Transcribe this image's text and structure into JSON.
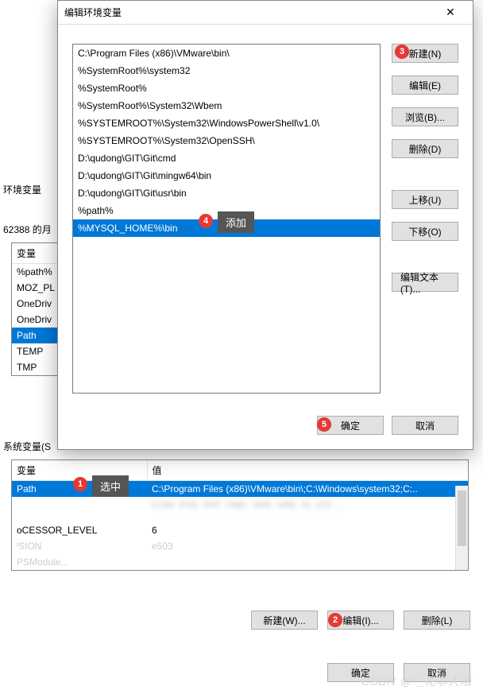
{
  "bg": {
    "env_label": "环境变量",
    "user_label": "62388 的月",
    "sys_label": "系统变量(S",
    "user_vars": {
      "headers": [
        "变量"
      ],
      "rows": [
        "%path%",
        "MOZ_PL",
        "OneDriv",
        "OneDriv",
        "Path",
        "TEMP",
        "TMP"
      ]
    },
    "sys_vars": {
      "headers": [
        "变量",
        "值"
      ],
      "rows": [
        {
          "name": "Path",
          "value": "C:\\Program Files (x86)\\VMware\\bin\\;C:\\Windows\\system32;C:..",
          "sel": true
        },
        {
          "name": "",
          "value": "COM. EVE. PAT. CMD. VRS. VRE. IS. ICE ...",
          "sel": false,
          "blur": true
        },
        {
          "name": "",
          "value": "",
          "sel": false,
          "blur": true
        },
        {
          "name": "",
          "value": "",
          "sel": false,
          "blur": true
        },
        {
          "name": "ᴏCESSOR_LEVEL",
          "value": "6",
          "sel": false
        },
        {
          "name": "              ᴵSION",
          "value": "e503",
          "sel": false,
          "blur2": true
        },
        {
          "name": "PSModule...",
          "value": "",
          "sel": false,
          "blur2": true
        }
      ]
    },
    "sys_buttons": {
      "new": "新建(W)...",
      "edit": "编辑(I)...",
      "delete": "删除(L)"
    },
    "parent_buttons": {
      "ok": "确定",
      "cancel": "取消"
    }
  },
  "dlg": {
    "title": "编辑环境变量",
    "close_glyph": "✕",
    "list": [
      "C:\\Program Files (x86)\\VMware\\bin\\",
      "%SystemRoot%\\system32",
      "%SystemRoot%",
      "%SystemRoot%\\System32\\Wbem",
      "%SYSTEMROOT%\\System32\\WindowsPowerShell\\v1.0\\",
      "%SYSTEMROOT%\\System32\\OpenSSH\\",
      "D:\\qudong\\GIT\\Git\\cmd",
      "D:\\qudong\\GIT\\Git\\mingw64\\bin",
      "D:\\qudong\\GIT\\Git\\usr\\bin",
      "%path%",
      "%MYSQL_HOME%\\bin"
    ],
    "selected_index": 10,
    "buttons": {
      "new": "新建(N)",
      "edit": "编辑(E)",
      "browse": "浏览(B)...",
      "delete": "删除(D)",
      "up": "上移(U)",
      "down": "下移(O)",
      "edit_text": "编辑文本(T)..."
    },
    "footer": {
      "ok": "确定",
      "cancel": "取消"
    }
  },
  "annotations": {
    "b1": "1",
    "t1": "选中",
    "b2": "2",
    "b3": "3",
    "b4": "4",
    "t4": "添加",
    "b5": "5"
  },
  "watermark": "CSDN @*_花非人陌"
}
